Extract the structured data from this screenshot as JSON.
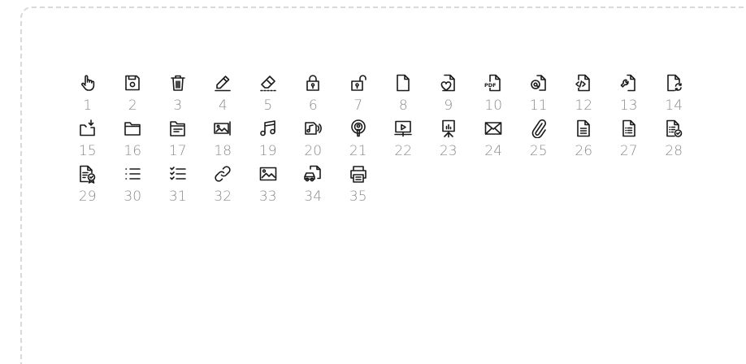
{
  "accent_color": "#1a1a1a",
  "label_color": "#8c8c8c",
  "icons": [
    {
      "num": "1",
      "icon": "hand-pointer-icon"
    },
    {
      "num": "2",
      "icon": "save-icon"
    },
    {
      "num": "3",
      "icon": "trash-icon"
    },
    {
      "num": "4",
      "icon": "pencil-icon"
    },
    {
      "num": "5",
      "icon": "eraser-icon"
    },
    {
      "num": "6",
      "icon": "lock-icon"
    },
    {
      "num": "7",
      "icon": "unlock-icon"
    },
    {
      "num": "8",
      "icon": "file-icon"
    },
    {
      "num": "9",
      "icon": "file-heart-icon"
    },
    {
      "num": "10",
      "icon": "file-pdf-icon"
    },
    {
      "num": "11",
      "icon": "file-at-icon"
    },
    {
      "num": "12",
      "icon": "file-code-icon"
    },
    {
      "num": "13",
      "icon": "file-wrench-icon"
    },
    {
      "num": "14",
      "icon": "file-sync-icon"
    },
    {
      "num": "15",
      "icon": "folder-download-icon"
    },
    {
      "num": "16",
      "icon": "folder-icon"
    },
    {
      "num": "17",
      "icon": "folder-open-icon"
    },
    {
      "num": "18",
      "icon": "image-gallery-icon"
    },
    {
      "num": "19",
      "icon": "music-note-icon"
    },
    {
      "num": "20",
      "icon": "audio-file-icon"
    },
    {
      "num": "21",
      "icon": "podcast-icon"
    },
    {
      "num": "22",
      "icon": "video-screen-icon"
    },
    {
      "num": "23",
      "icon": "presentation-icon"
    },
    {
      "num": "24",
      "icon": "mail-icon"
    },
    {
      "num": "25",
      "icon": "paperclip-icon"
    },
    {
      "num": "26",
      "icon": "document-icon"
    },
    {
      "num": "27",
      "icon": "document-list-icon"
    },
    {
      "num": "28",
      "icon": "document-check-icon"
    },
    {
      "num": "29",
      "icon": "certificate-icon"
    },
    {
      "num": "30",
      "icon": "list-icon"
    },
    {
      "num": "31",
      "icon": "checklist-icon"
    },
    {
      "num": "32",
      "icon": "link-icon"
    },
    {
      "num": "33",
      "icon": "image-icon"
    },
    {
      "num": "34",
      "icon": "car-document-icon"
    },
    {
      "num": "35",
      "icon": "printer-icon"
    }
  ]
}
